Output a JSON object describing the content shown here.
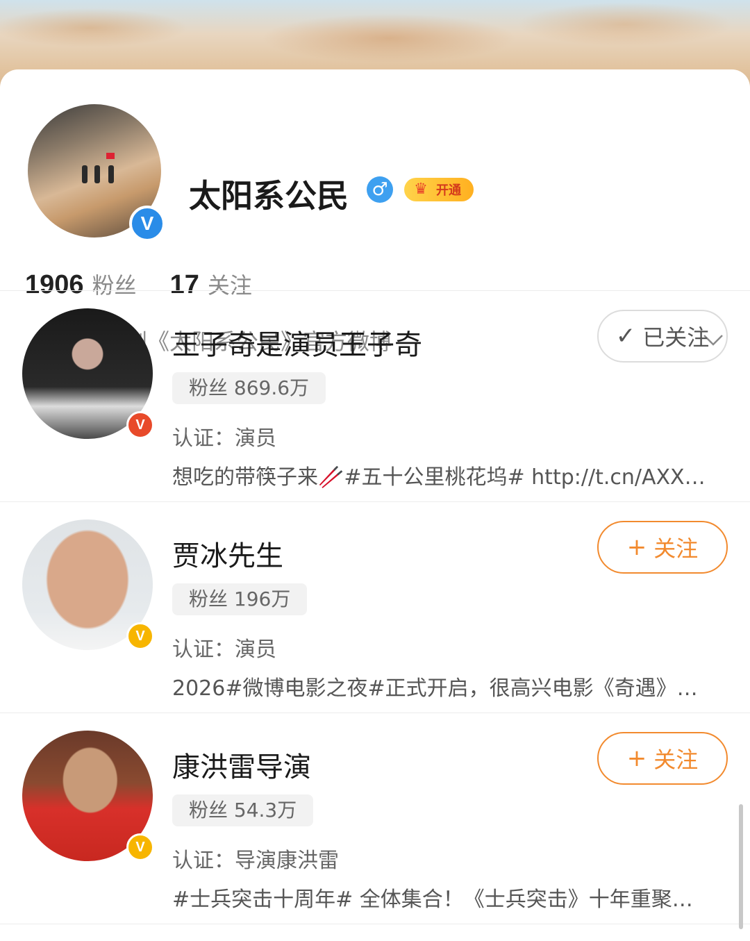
{
  "profile": {
    "name": "太阳系公民",
    "gender_symbol": "♂",
    "vip_label": "开通",
    "verify_mark": "V",
    "fans_count": "1906",
    "fans_label": "粉丝",
    "follow_count": "17",
    "follow_label": "关注",
    "certification": "电视剧《太阳系公民》官方微博"
  },
  "colors": {
    "accent_orange": "#f28a2e",
    "verify_blue": "#2a8ce8",
    "verify_red": "#e84a2a",
    "verify_yellow": "#f7b500"
  },
  "users": [
    {
      "name": "王子奇是演员王子奇",
      "fans": "粉丝 869.6万",
      "cert": "认证：演员",
      "desc": "想吃的带筷子来🥢#五十公里桃花坞# http://t.cn/AXX…",
      "button_icon": "✓",
      "button_label": "已关注",
      "badge": "V"
    },
    {
      "name": "贾冰先生",
      "fans": "粉丝 196万",
      "cert": "认证：演员",
      "desc": "2026#微博电影之夜#正式开启，很高兴电影《奇遇》…",
      "button_icon": "+",
      "button_label": "关注",
      "badge": "V"
    },
    {
      "name": "康洪雷导演",
      "fans": "粉丝 54.3万",
      "cert": "认证：导演康洪雷",
      "desc": "#士兵突击十周年# 全体集合！《士兵突击》十年重聚…",
      "button_icon": "+",
      "button_label": "关注",
      "badge": "V"
    }
  ]
}
